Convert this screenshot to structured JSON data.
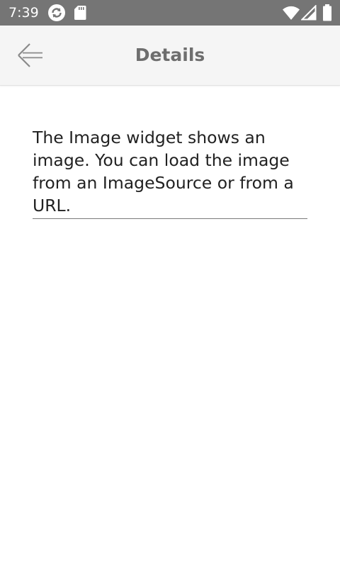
{
  "status_bar": {
    "time": "7:39",
    "icons": [
      "sync-icon",
      "sd-card-icon",
      "wifi-icon",
      "cellular-signal-icon",
      "battery-icon"
    ]
  },
  "app_bar": {
    "back_icon": "arrow-left-icon",
    "title": "Details"
  },
  "content": {
    "description": "The Image widget shows an image. You can load the image from an ImageSource or from a URL."
  },
  "colors": {
    "status_bar": "#757575",
    "app_bar": "#f5f5f5",
    "title_text": "#6e6e6e",
    "body_text": "#212121",
    "background": "#ffffff"
  }
}
